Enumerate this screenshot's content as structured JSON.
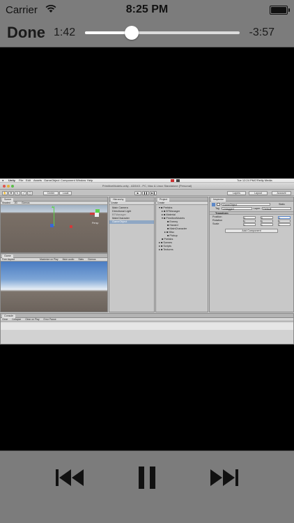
{
  "status_bar": {
    "carrier": "Carrier",
    "time": "8:25 PM",
    "icons": [
      "wifi-icon",
      "battery-icon"
    ],
    "battery_level": 1.0
  },
  "player": {
    "done_label": "Done",
    "elapsed": "1:42",
    "remaining": "-3:57",
    "progress": 0.3
  },
  "video_frame": {
    "menu_bar": {
      "app": "Unity",
      "items": [
        "File",
        "Edit",
        "Assets",
        "GameObject",
        "Component",
        "Window",
        "Help"
      ],
      "clock": "Tue 12:24 PM",
      "user": "O'Reilly Media"
    },
    "window_title": "PrimitiveModels.unity - ADD43 - PC, Mac & Linux Standalone (Personal)",
    "toolbar": {
      "center_label": "Center",
      "local_label": "Local",
      "layers_label": "Layers",
      "layout_label": "Layout",
      "account_label": "Account"
    },
    "scene": {
      "tab": "Scene",
      "options": [
        "Shaded",
        "2D",
        "Gizmos"
      ],
      "persp_label": "Persp"
    },
    "game": {
      "tab": "Game",
      "options": [
        "Free Aspect",
        "Maximize on Play",
        "Mute audio",
        "Stats",
        "Gizmos"
      ]
    },
    "hierarchy": {
      "tab": "Hierarchy",
      "create": "Create",
      "items": [
        "Main Camera",
        "Directional Light",
        "BTManager",
        "MainCharacter",
        "GameObject"
      ],
      "selected_index": 4
    },
    "project": {
      "tab": "Project",
      "create": "Create",
      "items": [
        "Prefabs",
        "BTManager",
        "Material",
        "PrimitiveModels",
        "Enemy",
        "Hazard",
        "MainCharacter",
        "Misc",
        "Pickup",
        "Scenes",
        "Scripts",
        "Textures"
      ]
    },
    "inspector": {
      "tab": "Inspector",
      "object_name": "GameObject",
      "static_label": "Static",
      "tag_label": "Tag",
      "tag_value": "Untagged",
      "layer_label": "Layer",
      "layer_value": "Default",
      "component": "Transform",
      "rows": [
        {
          "label": "Position",
          "x": "0",
          "y": "0",
          "z": "0"
        },
        {
          "label": "Rotation",
          "x": "0",
          "y": "0",
          "z": "0"
        },
        {
          "label": "Scale",
          "x": "1",
          "y": "1",
          "z": "1"
        }
      ],
      "add_component": "Add Component"
    },
    "console": {
      "tab": "Console",
      "options": [
        "Clear",
        "Collapse",
        "Clear on Play",
        "Error Pause"
      ]
    }
  },
  "controls": {
    "icons": [
      "previous-track-icon",
      "pause-icon",
      "next-track-icon"
    ]
  },
  "colors": {
    "chrome_gray": "#7c7c7c",
    "video_background": "#000000",
    "selection_blue": "#8fa7c4"
  }
}
